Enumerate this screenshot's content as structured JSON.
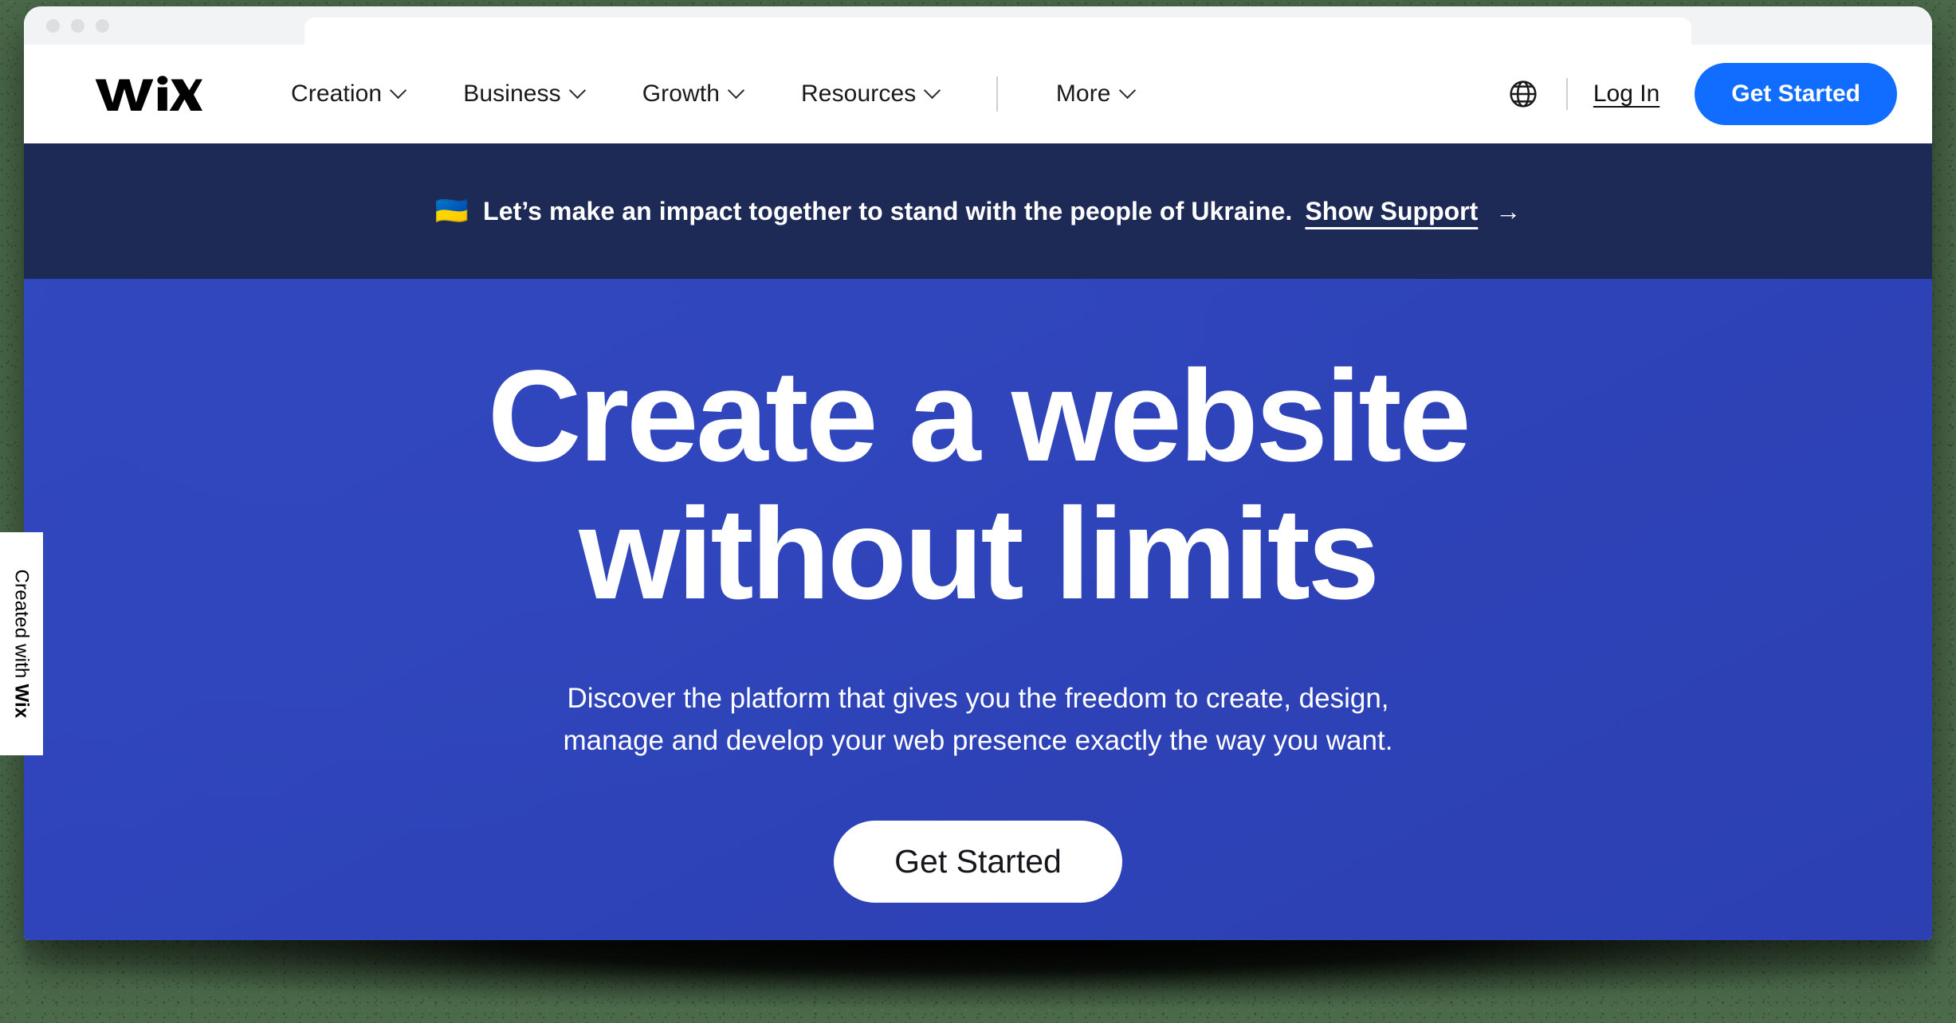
{
  "browser": {
    "traffic_lights": [
      "close-dot",
      "minimize-dot",
      "maximize-dot"
    ],
    "tab_label": ""
  },
  "nav": {
    "logo_text": "WiX",
    "items": [
      {
        "label": "Creation",
        "has_dropdown": true
      },
      {
        "label": "Business",
        "has_dropdown": true
      },
      {
        "label": "Growth",
        "has_dropdown": true
      },
      {
        "label": "Resources",
        "has_dropdown": true
      },
      {
        "label": "More",
        "has_dropdown": true
      }
    ],
    "language_icon": "globe-icon",
    "login_label": "Log In",
    "cta_label": "Get Started",
    "cta_color": "#116dff"
  },
  "banner": {
    "flag": "🇺🇦",
    "text": "Let’s make an impact together to stand with the people of Ukraine.",
    "link_label": "Show Support",
    "arrow": "→",
    "background_color": "#1e2a56"
  },
  "hero": {
    "title_line1": "Create a website",
    "title_line2": "without limits",
    "subtitle_line1": "Discover the platform that gives you the freedom to create, design,",
    "subtitle_line2": "manage and develop your web presence exactly the way you want.",
    "cta_label": "Get Started",
    "background_color": "#2e43b8"
  },
  "badge": {
    "prefix": "Created with ",
    "brand": "Wix"
  }
}
